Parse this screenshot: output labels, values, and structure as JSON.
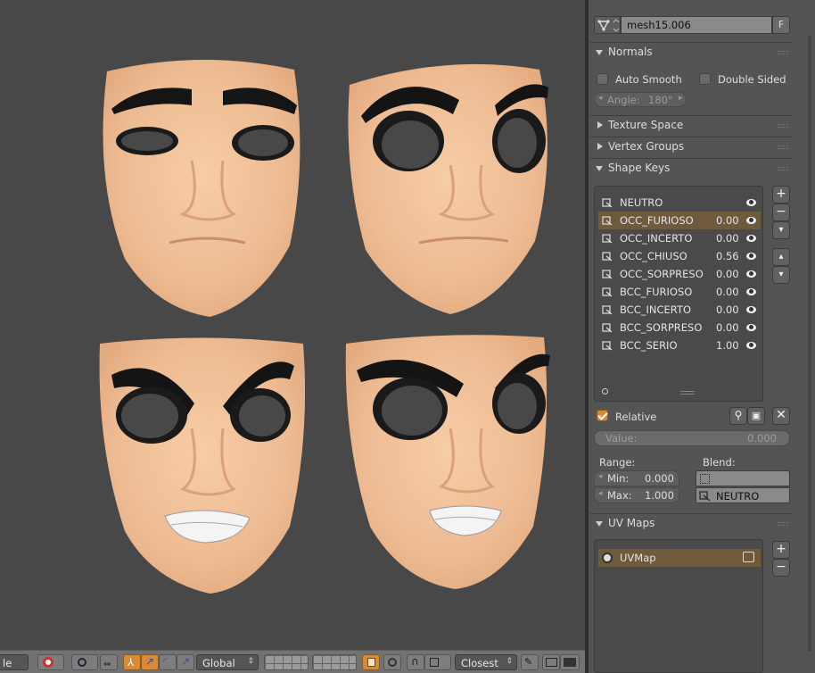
{
  "object": {
    "mesh_name": "mesh15.006",
    "fake_user_label": "F"
  },
  "normals": {
    "title": "Normals",
    "auto_smooth_label": "Auto Smooth",
    "double_sided_label": "Double Sided",
    "angle_label": "Angle:",
    "angle_value": "180°"
  },
  "panels": {
    "texture_space": "Texture Space",
    "vertex_groups": "Vertex Groups",
    "shape_keys": "Shape Keys",
    "uv_maps": "UV Maps"
  },
  "shape_keys": [
    {
      "name": "NEUTRO",
      "value": ""
    },
    {
      "name": "OCC_FURIOSO",
      "value": "0.00"
    },
    {
      "name": "OCC_INCERTO",
      "value": "0.00"
    },
    {
      "name": "OCC_CHIUSO",
      "value": "0.56"
    },
    {
      "name": "OCC_SORPRESO",
      "value": "0.00"
    },
    {
      "name": "BCC_FURIOSO",
      "value": "0.00"
    },
    {
      "name": "BCC_INCERTO",
      "value": "0.00"
    },
    {
      "name": "BCC_SORPRESO",
      "value": "0.00"
    },
    {
      "name": "BCC_SERIO",
      "value": "1.00"
    }
  ],
  "shape_key_controls": {
    "relative_label": "Relative",
    "value_label": "Value:",
    "value": "0.000",
    "range_label": "Range:",
    "min_label": "Min:",
    "min_value": "0.000",
    "max_label": "Max:",
    "max_value": "1.000",
    "blend_label": "Blend:",
    "blend_key": "NEUTRO"
  },
  "uv_maps": [
    {
      "name": "UVMap"
    }
  ],
  "toolbar": {
    "mode_fragment": "le",
    "orientation": "Global",
    "snap_target": "Closest"
  },
  "colors": {
    "accent": "#d88a35",
    "selected_row": "#6f5a3c",
    "panel_bg": "#545454",
    "viewport_bg": "#484848",
    "skin": "#f0c097"
  }
}
